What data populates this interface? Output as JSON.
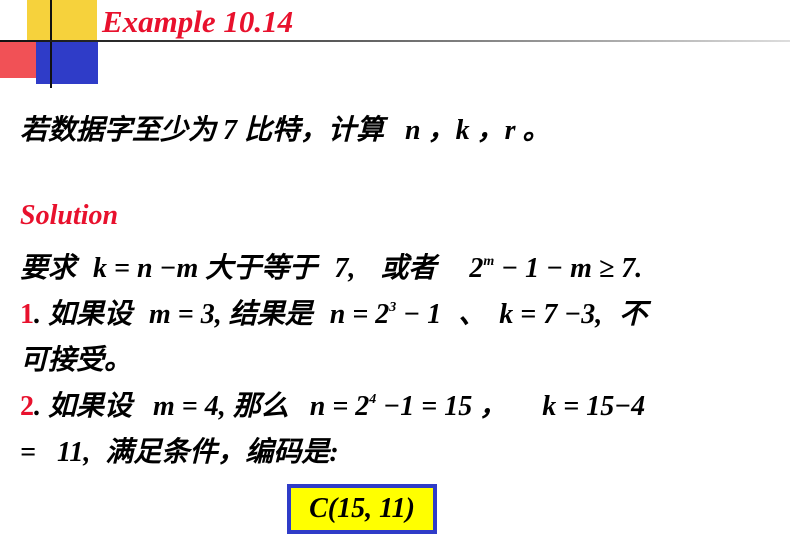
{
  "title": "Example 10.14",
  "question": {
    "text": "若数据字至少为 7 比特，计算",
    "vars": "n ，k ，r",
    "end": " 。"
  },
  "solution_label": "Solution",
  "line1": {
    "lead": "要求",
    "eq1": "k = n −m",
    "mid": "大于等于",
    "val": "7,",
    "or": "或者",
    "base": "2",
    "exp": "m",
    "tail": " − 1 − m ≥ 7."
  },
  "step1": {
    "num": "1",
    "text1": ". 如果设",
    "eq1": "m = 3,",
    "text2": "结果是",
    "base": "n = 2",
    "exp": "3",
    "tail": " − 1",
    "sep": "、",
    "eq2": "k = 7 −3,",
    "end": "不"
  },
  "step1_cont": "可接受。",
  "step2": {
    "num": "2",
    "text1": ". 如果设",
    "eq1": "m = 4,",
    "text2": "那么",
    "base": "n = 2",
    "exp": "4",
    "tail": " −1 = 15 ，",
    "eq2": "k = 15−4"
  },
  "step2_cont": {
    "eq": "=   11,",
    "text": "满足条件，编码是:"
  },
  "answer": "C(15, 11)",
  "colors": {
    "red": "#e8112d",
    "blue": "#2f3cc8",
    "yellow": "#ffff00"
  }
}
